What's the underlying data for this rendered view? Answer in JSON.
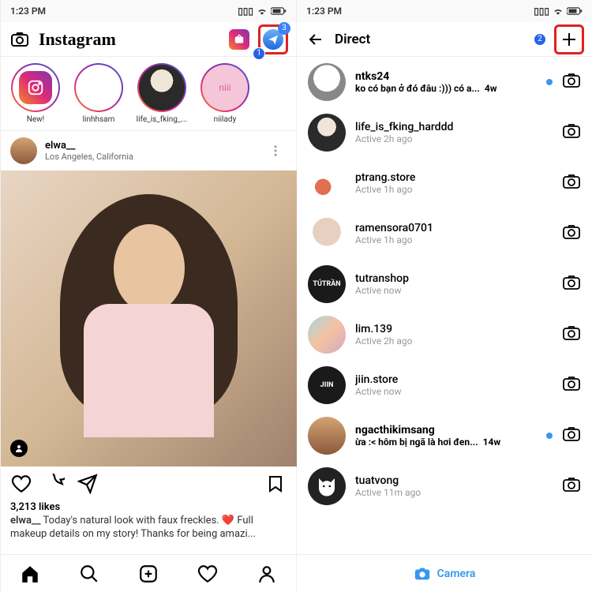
{
  "status": {
    "time": "1:23 PM"
  },
  "left": {
    "brand": "Instagram",
    "dm_badge": "3",
    "step1": "1",
    "stories": [
      {
        "label": "New!",
        "icon": "instagram"
      },
      {
        "label": "linhhsam",
        "icon": "blank"
      },
      {
        "label": "life_is_fking_...",
        "icon": "anime"
      },
      {
        "label": "niilady",
        "icon": "pink"
      }
    ],
    "post": {
      "user": "elwa__",
      "location": "Los Angeles, California",
      "likes": "3,213 likes",
      "caption_user": "elwa__",
      "caption": "Today's natural look with faux freckles. ❤️ Full makeup details on my story! Thanks for being amazi..."
    }
  },
  "right": {
    "title": "Direct",
    "step2": "2",
    "threads": [
      {
        "name": "ntks24",
        "sub": "ko có bạn ở đó đâu :))) có a...",
        "time": "4w",
        "bold": true,
        "dot": true,
        "av": "dog"
      },
      {
        "name": "life_is_fking_harddd",
        "sub": "Active 2h ago",
        "time": "",
        "bold": false,
        "dot": false,
        "av": "anime"
      },
      {
        "name": "ptrang.store",
        "sub": "Active 1h ago",
        "time": "",
        "bold": false,
        "dot": false,
        "av": "flower"
      },
      {
        "name": "ramensora0701",
        "sub": "Active 1h ago",
        "time": "",
        "bold": false,
        "dot": false,
        "av": "cat"
      },
      {
        "name": "tutranshop",
        "sub": "Active now",
        "time": "",
        "bold": false,
        "dot": false,
        "av": "black",
        "txt": "TÚTRẦN"
      },
      {
        "name": "lim.139",
        "sub": "Active 2h ago",
        "time": "",
        "bold": false,
        "dot": false,
        "av": "grad"
      },
      {
        "name": "jiin.store",
        "sub": "Active now",
        "time": "",
        "bold": false,
        "dot": false,
        "av": "black",
        "txt": "JIIN"
      },
      {
        "name": "ngacthikimsang",
        "sub": "ừa :< hôm bị ngã là hơi đen...",
        "time": "14w",
        "bold": true,
        "dot": true,
        "av": "person"
      },
      {
        "name": "tuatvong",
        "sub": "Active 11m ago",
        "time": "",
        "bold": false,
        "dot": false,
        "av": "catmask"
      }
    ],
    "camera": "Camera"
  }
}
